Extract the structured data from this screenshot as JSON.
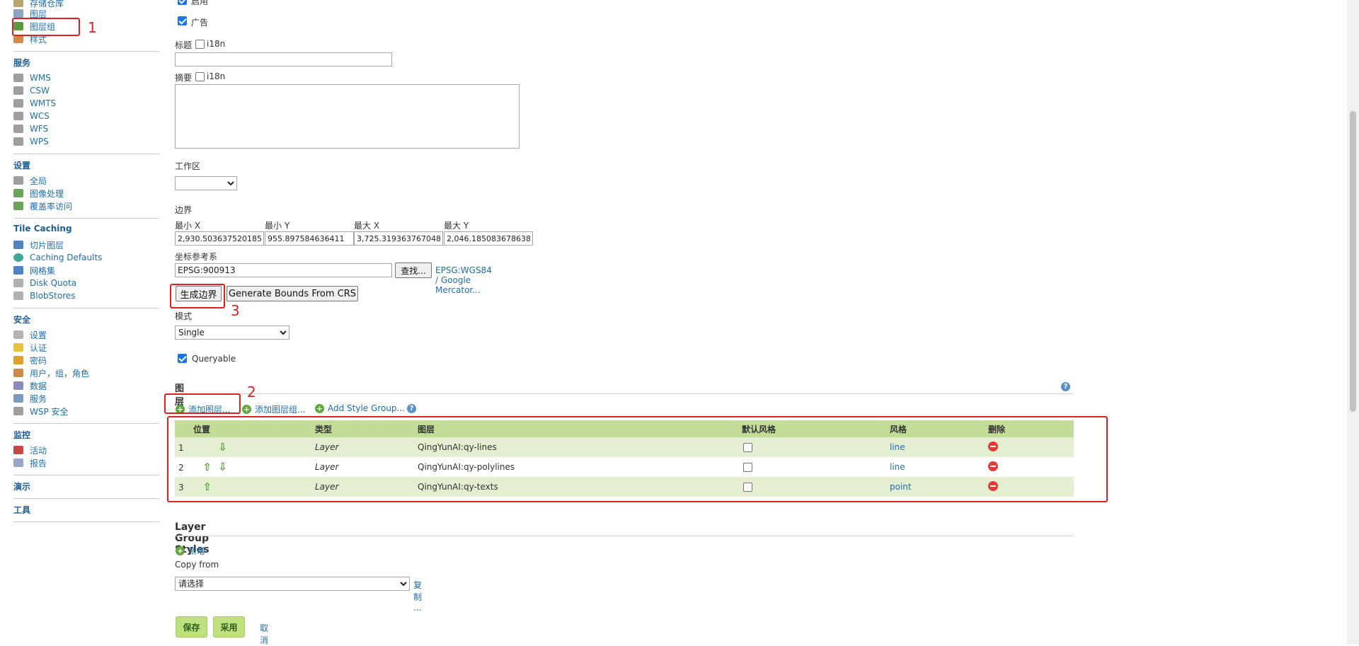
{
  "sidebar": {
    "top_items": [
      {
        "label": "存储仓库",
        "icon": "store-icon"
      },
      {
        "label": "图层",
        "icon": "layer-icon"
      },
      {
        "label": "图层组",
        "icon": "layergroup-icon"
      },
      {
        "label": "样式",
        "icon": "style-icon"
      }
    ],
    "sections": [
      {
        "title": "服务",
        "items": [
          {
            "label": "WMS",
            "icon": "server-icon"
          },
          {
            "label": "CSW",
            "icon": "server-icon"
          },
          {
            "label": "WMTS",
            "icon": "server-icon"
          },
          {
            "label": "WCS",
            "icon": "server-icon"
          },
          {
            "label": "WFS",
            "icon": "server-icon"
          },
          {
            "label": "WPS",
            "icon": "server-icon"
          }
        ]
      },
      {
        "title": "设置",
        "items": [
          {
            "label": "全局",
            "icon": "server-icon"
          },
          {
            "label": "图像处理",
            "icon": "image-icon"
          },
          {
            "label": "覆盖率访问",
            "icon": "image-icon"
          }
        ]
      },
      {
        "title": "Tile Caching",
        "items": [
          {
            "label": "切片图层",
            "icon": "grid-icon"
          },
          {
            "label": "Caching Defaults",
            "icon": "globe-icon"
          },
          {
            "label": "网格集",
            "icon": "grid-icon"
          },
          {
            "label": "Disk Quota",
            "icon": "disk-icon"
          },
          {
            "label": "BlobStores",
            "icon": "disk-icon"
          }
        ]
      },
      {
        "title": "安全",
        "items": [
          {
            "label": "设置",
            "icon": "key-icon"
          },
          {
            "label": "认证",
            "icon": "shield-icon"
          },
          {
            "label": "密码",
            "icon": "lock-icon"
          },
          {
            "label": "用户，组，角色",
            "icon": "users-icon"
          },
          {
            "label": "数据",
            "icon": "data-icon"
          },
          {
            "label": "服务",
            "icon": "service-icon"
          },
          {
            "label": "WSP 安全",
            "icon": "server-icon"
          }
        ]
      },
      {
        "title": "监控",
        "items": [
          {
            "label": "活动",
            "icon": "chart-icon"
          },
          {
            "label": "报告",
            "icon": "report-icon"
          }
        ]
      },
      {
        "title": "演示",
        "items": []
      },
      {
        "title": "工具",
        "items": []
      }
    ]
  },
  "form": {
    "enabled_label": "启用",
    "enabled_checked": true,
    "advertised_label": "广告",
    "advertised_checked": true,
    "title_label": "标题",
    "title_i18n": "i18n",
    "title_value": "",
    "abstract_label": "摘要",
    "abstract_i18n": "i18n",
    "abstract_value": "",
    "workspace_label": "工作区",
    "workspace_value": "",
    "bounds_label": "边界",
    "bounds": {
      "minx_label": "最小 X",
      "minx": "2,930.5036375201853",
      "miny_label": "最小 Y",
      "miny": "955.897584636411",
      "maxx_label": "最大 X",
      "maxx": "3,725.319363767048",
      "maxy_label": "最大 Y",
      "maxy": "2,046.1850836786389"
    },
    "crs_label": "坐标参考系",
    "crs_value": "EPSG:900913",
    "find_button": "查找...",
    "crs_link": "EPSG:WGS84 / Google Mercator...",
    "gen_bounds_button": "生成边界",
    "gen_bounds_crs_button": "Generate Bounds From CRS",
    "mode_label": "模式",
    "mode_value": "Single",
    "queryable_label": "Queryable",
    "queryable_checked": true
  },
  "layers_section": {
    "title": "图层",
    "add_layer": "添加图层...",
    "add_layer_group": "添加图层组...",
    "add_style_group": "Add Style Group...",
    "columns": [
      "位置",
      "类型",
      "图层",
      "默认风格",
      "风格",
      "删除"
    ],
    "rows": [
      {
        "pos": "1",
        "up": false,
        "down": true,
        "type": "Layer",
        "layer": "QingYunAI:qy-lines",
        "default_style": false,
        "style": "line"
      },
      {
        "pos": "2",
        "up": true,
        "down": true,
        "type": "Layer",
        "layer": "QingYunAI:qy-polylines",
        "default_style": false,
        "style": "line"
      },
      {
        "pos": "3",
        "up": true,
        "down": false,
        "type": "Layer",
        "layer": "QingYunAI:qy-texts",
        "default_style": false,
        "style": "point"
      }
    ]
  },
  "styles_section": {
    "title": "Layer Group Styles",
    "add_new": "新增",
    "copy_from_label": "Copy from",
    "copy_select_value": "请选择",
    "copy_link": "复制 ..."
  },
  "actions": {
    "save": "保存",
    "apply": "采用",
    "cancel": "取消"
  },
  "annotations": [
    "1",
    "2",
    "3"
  ],
  "colors": {
    "annotation": "#e02020",
    "table_header": "#c3dc98",
    "table_odd_row": "#e4efd2",
    "link": "#1d6eb0",
    "button_green": "#bfe07f"
  }
}
